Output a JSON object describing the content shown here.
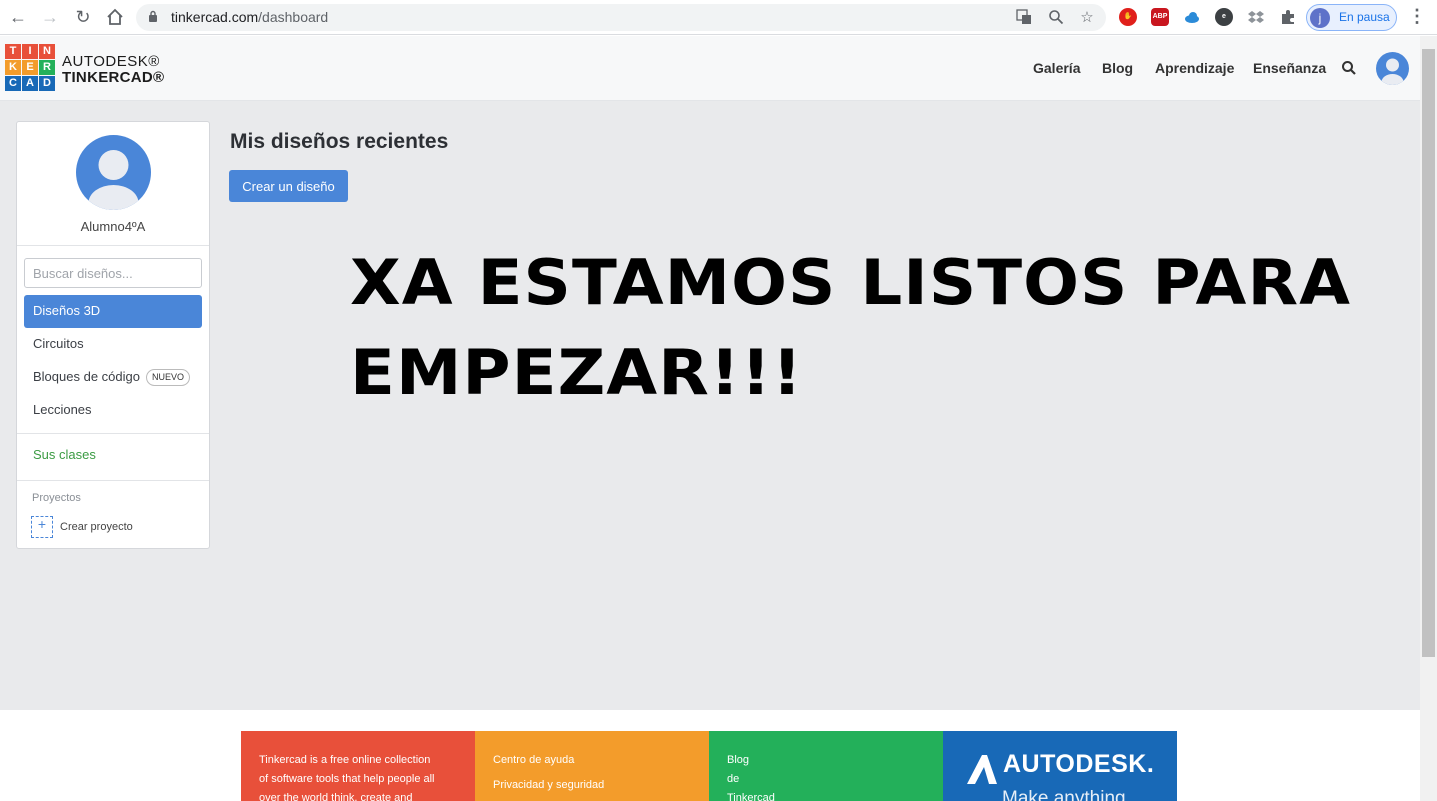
{
  "browser": {
    "url_host": "tinkercad.com",
    "url_path": "/dashboard",
    "profile_initial": "j",
    "profile_status": "En pausa",
    "extensions": [
      "ABP"
    ]
  },
  "header": {
    "logo_letters": [
      "T",
      "I",
      "N",
      "K",
      "E",
      "R",
      "C",
      "A",
      "D"
    ],
    "brand_top": "AUTODESK®",
    "brand_bottom": "TINKERCAD®",
    "nav": [
      "Galería",
      "Blog",
      "Aprendizaje",
      "Enseñanza"
    ]
  },
  "sidebar": {
    "username": "Alumno4ºA",
    "search_placeholder": "Buscar diseños...",
    "items": [
      {
        "label": "Diseños 3D"
      },
      {
        "label": "Circuitos"
      },
      {
        "label": "Bloques de código",
        "badge": "NUEVO"
      },
      {
        "label": "Lecciones"
      }
    ],
    "classes_link": "Sus clases",
    "projects_label": "Proyectos",
    "create_project": "Crear proyecto"
  },
  "main": {
    "title": "Mis diseños recientes",
    "create_button": "Crear un diseño",
    "overlay_line1": "XA ESTAMOS LISTOS PARA",
    "overlay_line2": "EMPEZAR!!!"
  },
  "footer": {
    "about_lines": [
      "Tinkercad is a free online collection",
      "of software tools that help people all",
      "over the world think, create and"
    ],
    "help_links": [
      "Centro de ayuda",
      "Privacidad y seguridad"
    ],
    "blog_lines": [
      "Blog",
      "de",
      "Tinkercad"
    ],
    "autodesk_name": "AUTODESK.",
    "autodesk_tagline": "Make anything"
  },
  "colors": {
    "accent_blue": "#4a86d8",
    "green_link": "#3b9b43",
    "footer_red": "#e8503a",
    "footer_orange": "#f39c2b",
    "footer_green": "#23b05a",
    "footer_blue": "#1869b7"
  }
}
